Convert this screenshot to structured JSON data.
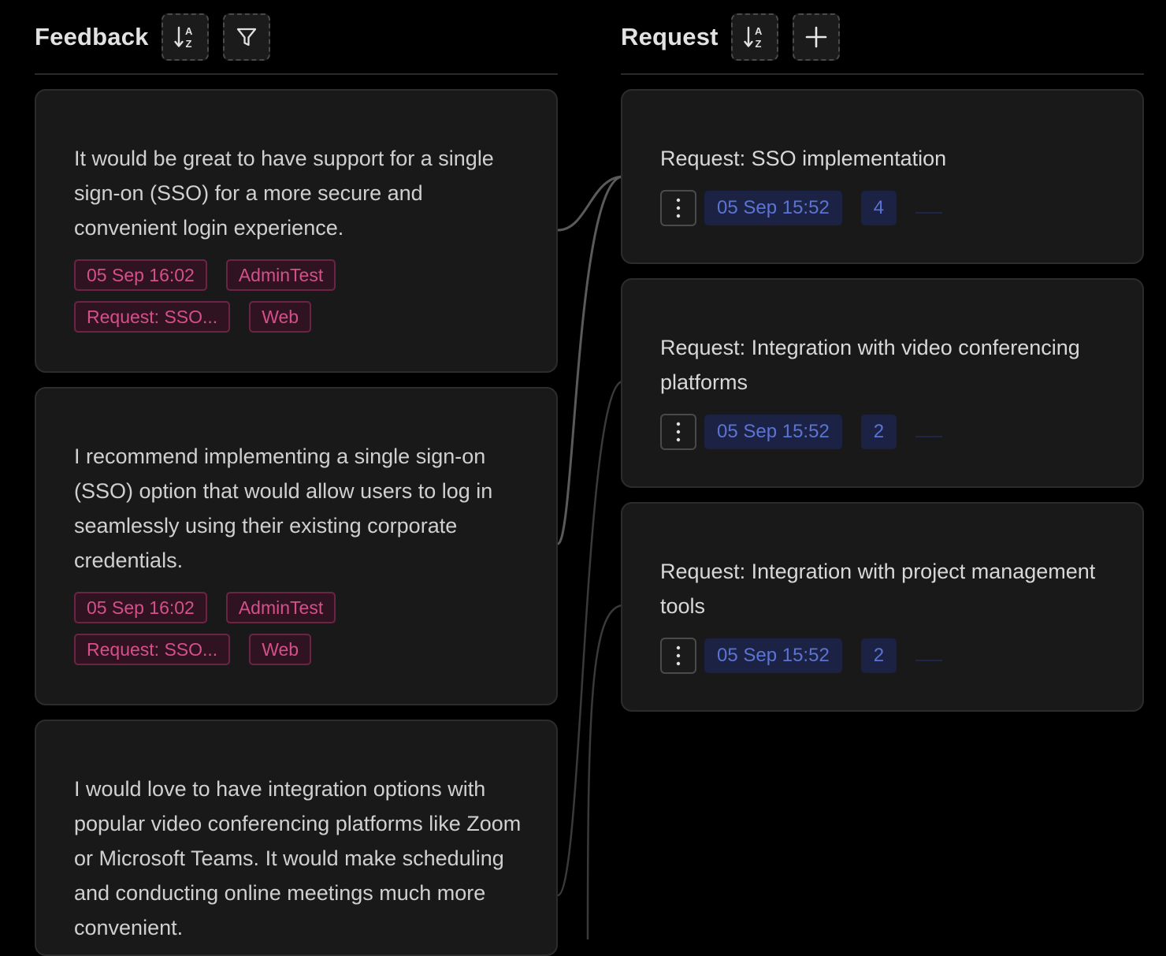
{
  "feedback": {
    "title": "Feedback",
    "sort_icon": "sort-alpha-icon",
    "filter_icon": "filter-icon",
    "cards": [
      {
        "text": "It would be great to have support for a single sign-on (SSO) for a more secure and convenient login experience.",
        "tags": [
          "05 Sep 16:02",
          "AdminTest",
          "Request: SSO...",
          "Web"
        ]
      },
      {
        "text": "I recommend implementing a single sign-on (SSO) option that would allow users to log in seamlessly using their existing corporate credentials.",
        "tags": [
          "05 Sep 16:02",
          "AdminTest",
          "Request: SSO...",
          "Web"
        ]
      },
      {
        "text": "I would love to have integration options with popular video conferencing platforms like Zoom or Microsoft Teams. It would make scheduling and conducting online meetings much more convenient."
      }
    ]
  },
  "request": {
    "title": "Request",
    "sort_icon": "sort-alpha-icon",
    "add_icon": "plus-icon",
    "cards": [
      {
        "title": "Request: SSO implementation",
        "date": "05 Sep 15:52",
        "count": "4"
      },
      {
        "title": "Request: Integration with video conferencing platforms",
        "date": "05 Sep 15:52",
        "count": "2"
      },
      {
        "title": "Request: Integration with project management tools",
        "date": "05 Sep 15:52",
        "count": "2"
      }
    ]
  },
  "colors": {
    "background": "#000000",
    "card": "#191919",
    "tag_text": "#d4508a",
    "badge_text": "#5b74d4",
    "link_line": "#5a5a5a"
  }
}
